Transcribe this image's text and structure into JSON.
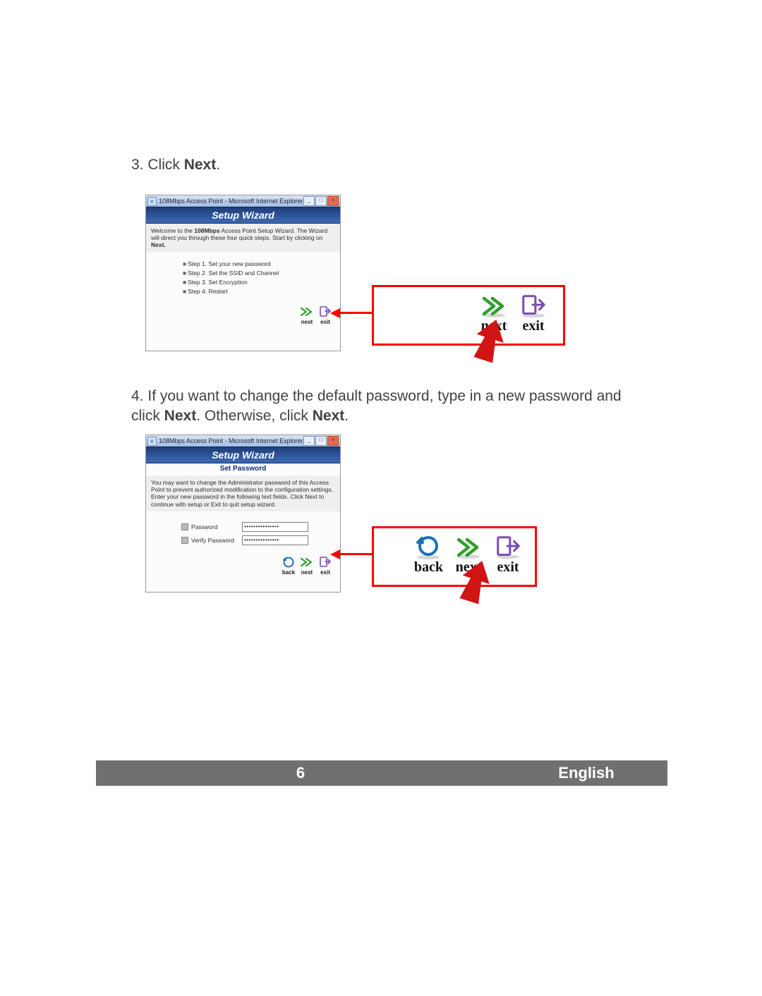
{
  "instr3_prefix": "3. ",
  "instr3_text_a": "Click ",
  "instr3_bold": "Next",
  "instr3_text_b": ".",
  "instr4_prefix": "4. ",
  "instr4_text_a": "If you want to change the default password, type in a new password and click ",
  "instr4_bold1": "Next",
  "instr4_text_b": ".  Otherwise, click ",
  "instr4_bold2": "Next",
  "instr4_text_c": ".",
  "win1": {
    "title": "108Mbps Access Point - Microsoft Internet Explorer",
    "ribbon": "Setup Wizard",
    "welcome_a": "Welcome to the ",
    "welcome_bold1": "108Mbps",
    "welcome_b": " Access Point Setup Wizard. The Wizard will direct you through these four quick steps. Start by clicking on ",
    "welcome_bold2": "Next.",
    "steps": [
      "Step 1. Set your new password",
      "Step 2. Set the SSID and Channel",
      "Step 3. Set Encryption",
      "Step 4. Restart"
    ],
    "next": "next",
    "exit": "exit"
  },
  "win2": {
    "title": "108Mbps Access Point - Microsoft Internet Explorer",
    "ribbon": "Setup Wizard",
    "subtitle": "Set Password",
    "desc": "You may want to change the Administrator password of this Access Point to prevent authorized modification to the configuration settings. Enter your new password in the following text fields. Click Next to continue with setup or Exit to quit setup wizard.",
    "pw_label": "Password",
    "vpw_label": "Verify Password",
    "pw_mask": "•••••••••••••••",
    "back": "back",
    "next": "next",
    "exit": "exit"
  },
  "callout1": {
    "next": "next",
    "exit": "exit"
  },
  "callout2": {
    "back": "back",
    "next": "next",
    "exit": "exit"
  },
  "footer": {
    "page": "6",
    "language": "English"
  }
}
